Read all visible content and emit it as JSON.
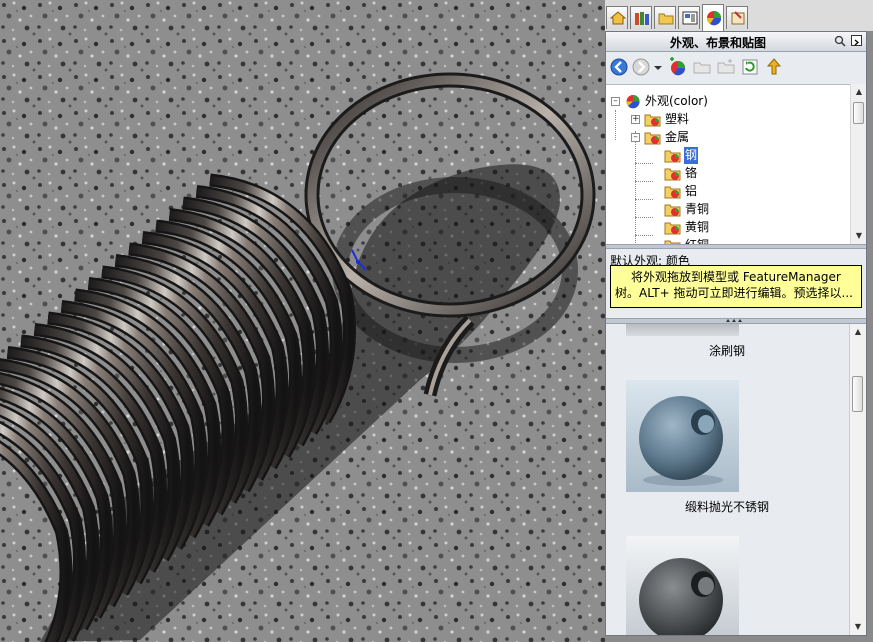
{
  "panel": {
    "title": "外观、布景和贴图",
    "tabs": [
      {
        "icon": "home-icon"
      },
      {
        "icon": "design-library-icon"
      },
      {
        "icon": "file-explorer-icon"
      },
      {
        "icon": "view-palette-icon"
      },
      {
        "icon": "appearances-icon",
        "active": true
      },
      {
        "icon": "custom-properties-icon"
      }
    ],
    "toolbar": [
      "back-icon",
      "forward-icon",
      "dropdown-icon",
      "add-appearance-icon",
      "folder-icon",
      "new-folder-icon",
      "refresh-icon",
      "add-to-favorites-icon"
    ]
  },
  "tree": {
    "root": "外观(color)",
    "plastic": "塑料",
    "metal": "金属",
    "children": [
      {
        "label": "钢",
        "selected": true
      },
      {
        "label": "铬"
      },
      {
        "label": "铝"
      },
      {
        "label": "青铜"
      },
      {
        "label": "黄铜"
      },
      {
        "label": "红铜"
      }
    ]
  },
  "default_appearance": "默认外观: 颜色",
  "tooltip": {
    "line1": "将外观拖放到模型或 FeatureManager",
    "line2": "树。ALT+ 拖动可立即进行编辑。预选择以..."
  },
  "swatches": [
    {
      "label": "涂刷钢"
    },
    {
      "label": "缎料抛光不锈钢"
    },
    {
      "label": ""
    }
  ],
  "colors": {
    "selection": "#3a6fd8",
    "tooltip_bg": "#ffff99",
    "panel_bg": "#e8ebef"
  }
}
